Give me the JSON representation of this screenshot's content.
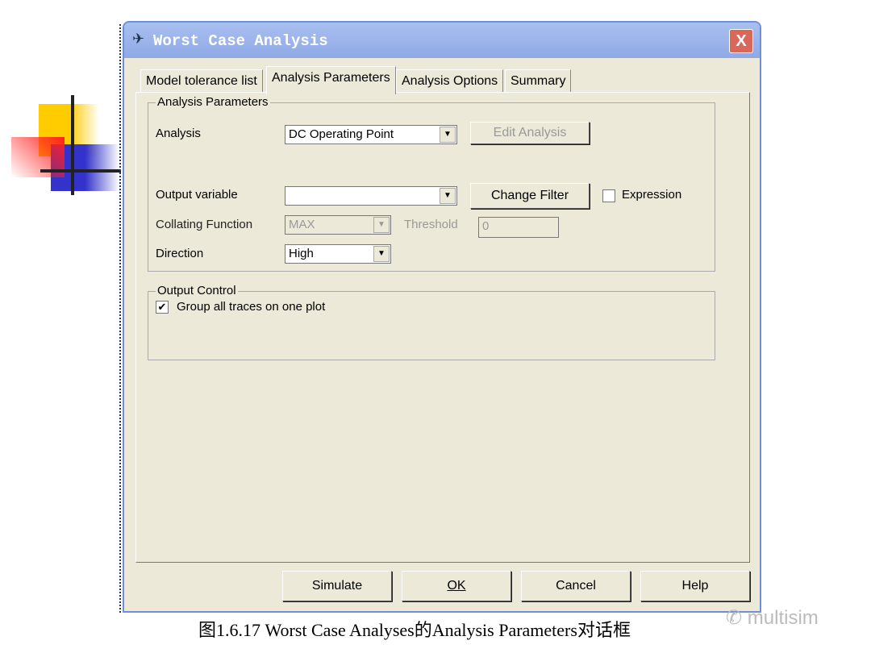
{
  "window": {
    "title": "Worst Case Analysis",
    "close": "X"
  },
  "tabs": [
    {
      "label": "Model tolerance list"
    },
    {
      "label": "Analysis Parameters",
      "active": true
    },
    {
      "label": "Analysis Options"
    },
    {
      "label": "Summary"
    }
  ],
  "params": {
    "group_label": "Analysis Parameters",
    "analysis_label": "Analysis",
    "analysis_value": "DC Operating Point",
    "edit_analysis": "Edit Analysis",
    "output_label": "Output variable",
    "output_value": "",
    "change_filter": "Change Filter",
    "expression_label": "Expression",
    "expression_checked": false,
    "collating_label": "Collating Function",
    "collating_value": "MAX",
    "threshold_label": "Threshold",
    "threshold_value": "0",
    "direction_label": "Direction",
    "direction_value": "High"
  },
  "output": {
    "group_label": "Output Control",
    "group_traces_label": "Group all traces on one plot",
    "group_traces_checked": true,
    "check_glyph": "✔"
  },
  "buttons": {
    "simulate": "Simulate",
    "ok": "OK",
    "cancel": "Cancel",
    "help": "Help"
  },
  "caption": "图1.6.17 Worst Case Analyses的Analysis Parameters对话框",
  "watermark": "multisim",
  "colors": {
    "titlebar": "#8fa9e6",
    "dialog": "#ece9d8",
    "close": "#d9675a"
  }
}
